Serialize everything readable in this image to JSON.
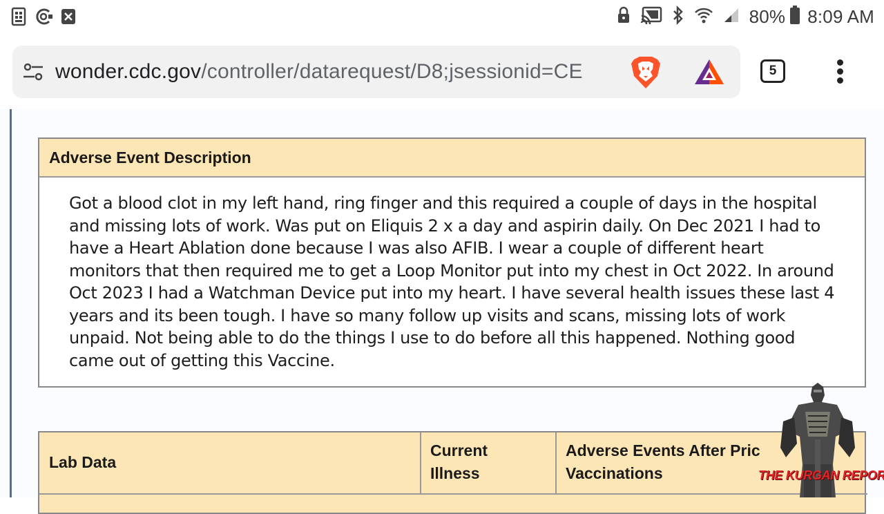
{
  "status_bar": {
    "battery": "80%",
    "time": "8:09 AM",
    "left_icons": [
      "sim-card-icon",
      "voice-assistant-icon",
      "close-box-icon"
    ],
    "right_icons": [
      "lock-icon",
      "cast-icon",
      "bluetooth-icon",
      "wifi-icon",
      "signal-icon",
      "battery-icon"
    ]
  },
  "browser": {
    "url_host": "wonder.cdc.gov",
    "url_path": "/controller/datarequest/D8;jsessionid=CE",
    "tab_count": "5",
    "icons": [
      "tune-icon",
      "brave-lion-icon",
      "bat-rewards-icon",
      "more-vert-icon"
    ]
  },
  "report": {
    "description_header": "Adverse Event Description",
    "description_text": "Got a blood clot in my left hand, ring finger and this required a couple of days in the hospital and missing lots of work. Was put on Eliquis 2 x a day and aspirin daily. On Dec 2021 I had to have a Heart Ablation done because I was also AFIB. I wear a couple of different heart monitors that then required me to get a Loop Monitor put into my chest in Oct 2022. In around Oct 2023 I had a Watchman Device put into my heart. I have several health issues these last 4 years and its been tough. I have so many follow up visits and scans, missing lots of work unpaid. Not being able to do the things I use to do before all this happened. Nothing good came out of getting this Vaccine.",
    "table_headers": [
      "Lab Data",
      "Current Illness",
      "Adverse Events After Pric Vaccinations"
    ]
  },
  "watermark": {
    "text": "THE KURGAN REPORT"
  },
  "colors": {
    "header_fill": "#fde6b6",
    "page_background": "#fbfcff",
    "watermark_red": "#e0262b"
  }
}
